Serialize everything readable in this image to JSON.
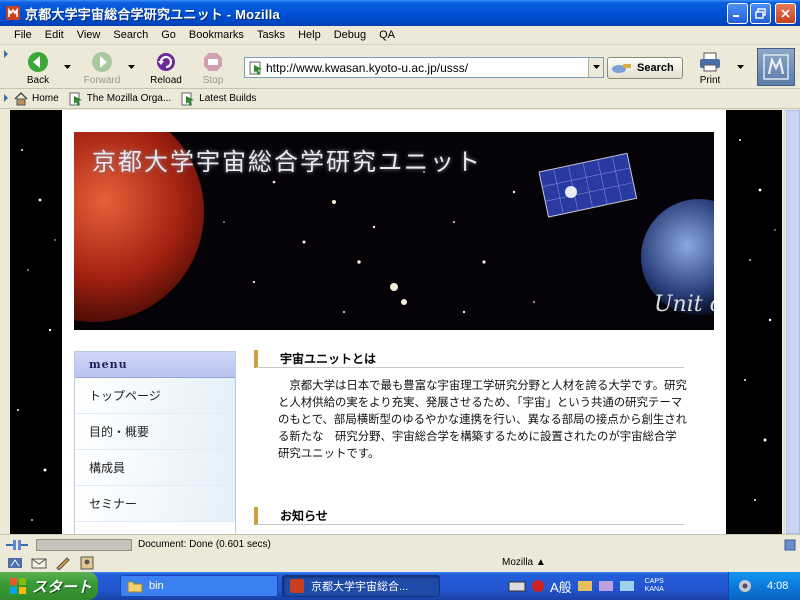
{
  "window": {
    "title": "京都大学宇宙総合学研究ユニット - Mozilla"
  },
  "menubar": {
    "items": [
      {
        "label": "File",
        "ul": "F"
      },
      {
        "label": "Edit",
        "ul": "E"
      },
      {
        "label": "View",
        "ul": "V"
      },
      {
        "label": "Search",
        "ul": "S"
      },
      {
        "label": "Go",
        "ul": "G"
      },
      {
        "label": "Bookmarks",
        "ul": "B"
      },
      {
        "label": "Tasks",
        "ul": "T"
      },
      {
        "label": "Help",
        "ul": "H"
      },
      {
        "label": "Debug",
        "ul": "D"
      },
      {
        "label": "QA",
        "ul": "Q"
      }
    ]
  },
  "navbar": {
    "back_label": "Back",
    "forward_label": "Forward",
    "reload_label": "Reload",
    "stop_label": "Stop",
    "url": "http://www.kwasan.kyoto-u.ac.jp/usss/",
    "search_label": "Search",
    "print_label": "Print"
  },
  "personalbar": {
    "items": [
      "Home",
      "The Mozilla Orga...",
      "Latest Builds"
    ]
  },
  "page": {
    "banner_title": "京都大学宇宙総合学研究ユニット",
    "banner_unit": "Unit o",
    "menu_header": "menu",
    "menu_items": [
      "トップページ",
      "目的・概要",
      "構成員",
      "セミナー"
    ],
    "section1_title": "宇宙ユニットとは",
    "section1_body": "京都大学は日本で最も豊富な宇宙理工学研究分野と人材を誇る大学です。研究と人材供給の実をより充実、発展させるため、「宇宙」という共通の研究テーマのもとで、部局横断型のゆるやかな連携を行い、異なる部局の接点から創生される新たな　研究分野、宇宙総合学を構築するために設置されたのが宇宙総合学研究ユニットです。",
    "section2_title": "お知らせ"
  },
  "statusbar": {
    "text": "Document: Done (0.601 secs)"
  },
  "componentbar": {
    "label": "Mozilla"
  },
  "taskbar": {
    "start_label": "スタート",
    "items": [
      "bin",
      "京都大学宇宙総合..."
    ],
    "ime_label": "A般",
    "caps_label": "CAPS",
    "kana_label": "KANA",
    "clock": "4:08"
  },
  "colors": {
    "titlebar": "#0052d6",
    "menu_header_bg": "#c4ccf4",
    "section_accent": "#c8a040",
    "start_green": "#3b9a37"
  }
}
